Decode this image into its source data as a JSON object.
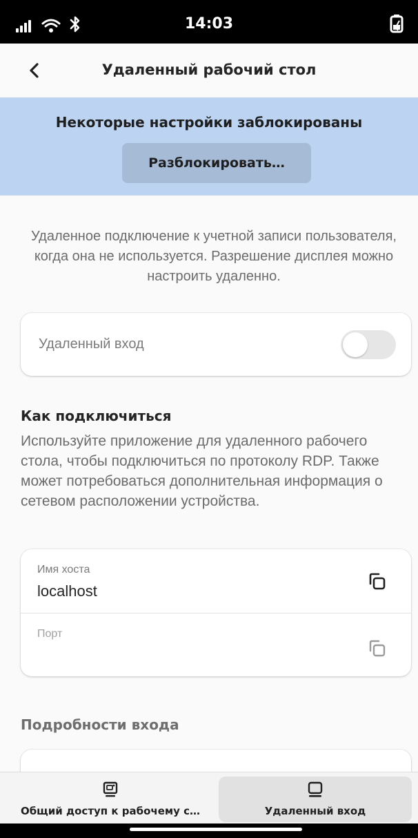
{
  "status_bar": {
    "time": "14:03",
    "icons": [
      "signal-icon",
      "wifi-icon",
      "bluetooth-icon",
      "battery-charging-icon"
    ]
  },
  "header": {
    "title": "Удаленный рабочий стол",
    "back_icon": "chevron-left-icon"
  },
  "banner": {
    "title": "Некоторые настройки заблокированы",
    "unlock_label": "Разблокировать…",
    "background": "#bcd4f1"
  },
  "description": "Удаленное подключение к учетной записи пользователя, когда она не используется. Разрешение дисплея можно настроить удаленно.",
  "remote_login": {
    "label": "Удаленный вход",
    "enabled": false
  },
  "how_to_connect": {
    "title": "Как подключиться",
    "text": "Используйте приложение для удаленного рабочего стола, чтобы подключиться по протоколу RDP. Также может потребоваться дополнительная информация о сетевом расположении устройства.",
    "hostname": {
      "label": "Имя хоста",
      "value": "localhost",
      "copy_icon": "copy-icon"
    },
    "port": {
      "label": "Порт",
      "value": "",
      "copy_icon": "copy-icon"
    }
  },
  "login_details": {
    "title": "Подробности входа"
  },
  "bottom_nav": {
    "items": [
      {
        "label": "Общий доступ к рабочему с…",
        "icon": "desktop-sharing-icon",
        "selected": false
      },
      {
        "label": "Удаленный вход",
        "icon": "laptop-icon",
        "selected": true
      }
    ]
  }
}
